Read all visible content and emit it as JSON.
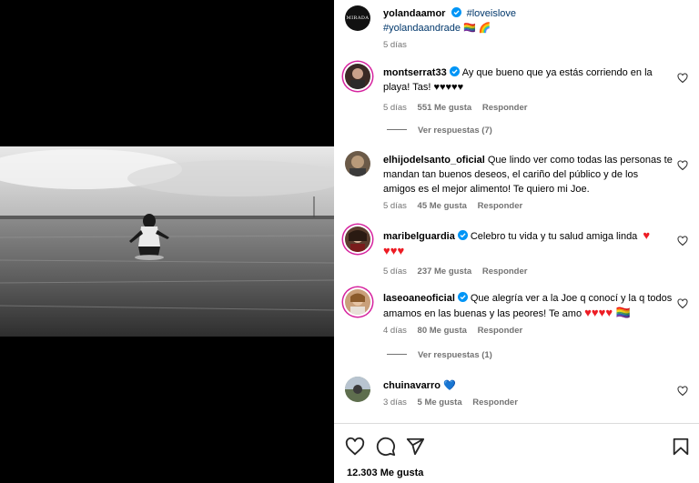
{
  "post": {
    "author": "yolandaamor",
    "avatar_text": "MIRADA",
    "caption_tag1": "#loveislove",
    "caption_tag2": "#yolandaandrade",
    "caption_emoji": "🏳️‍🌈 🌈",
    "time": "5 días"
  },
  "comments": [
    {
      "user": "montserrat33",
      "verified": true,
      "text": "Ay que bueno que ya estás corriendo en la playa! Tas! ♥♥♥♥♥",
      "time": "5 días",
      "likes": "551 Me gusta",
      "reply": "Responder",
      "replies_label": "Ver respuestas (7)"
    },
    {
      "user": "elhijodelsanto_oficial",
      "verified": false,
      "text": "Que lindo ver como todas las personas te mandan tan buenos deseos, el cariño del público y de los amigos es el mejor alimento! Te quiero mi Joe.",
      "time": "5 días",
      "likes": "45 Me gusta",
      "reply": "Responder"
    },
    {
      "user": "maribelguardia",
      "verified": true,
      "text": "Celebro tu vida y tu salud amiga linda",
      "hearts": "♥ ♥♥♥",
      "time": "5 días",
      "likes": "237 Me gusta",
      "reply": "Responder"
    },
    {
      "user": "laseoaneoficial",
      "verified": true,
      "text": "Que alegría ver a la Joe q conocí y la q todos amamos en las buenas y las peores! Te amo",
      "hearts": "♥♥♥♥ 🏳️‍🌈",
      "time": "4 días",
      "likes": "80 Me gusta",
      "reply": "Responder",
      "replies_label": "Ver respuestas (1)"
    },
    {
      "user": "chuinavarro",
      "verified": false,
      "text": "💙",
      "time": "3 días",
      "likes": "5 Me gusta",
      "reply": "Responder"
    }
  ],
  "footer": {
    "likes_count": "12.303 Me gusta"
  },
  "colors": {
    "verified": "#0095f6",
    "heart_red": "#ed1c24",
    "link": "#00376b",
    "muted": "#737373"
  }
}
